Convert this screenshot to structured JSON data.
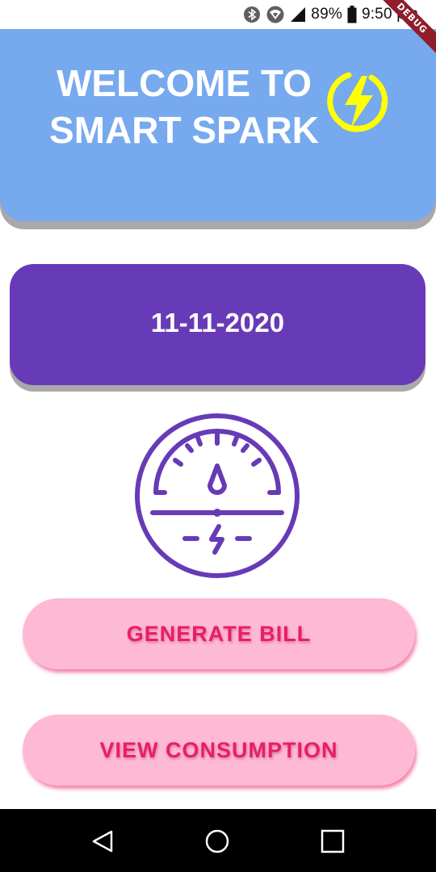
{
  "status_bar": {
    "battery_percent": "89%",
    "time": "9:50 pm",
    "icons": [
      "bluetooth-icon",
      "wifi-icon",
      "signal-icon",
      "battery-icon"
    ]
  },
  "debug_banner": "DEBUG",
  "header": {
    "title_line1": "WELCOME TO",
    "title_line2": "SMART SPARK",
    "logo_icon": "lightning-bolt-icon",
    "background_color": "#76a9ee",
    "logo_color": "#ffff00"
  },
  "date_card": {
    "date": "11-11-2020",
    "background_color": "#673ab7"
  },
  "meter_illustration": {
    "icon": "electric-meter-icon",
    "color": "#673ab7"
  },
  "buttons": {
    "generate_bill": "GENERATE BILL",
    "view_consumption": "VIEW CONSUMPTION",
    "background_color": "#feb9d5",
    "text_color": "#e91e63"
  },
  "nav_bar": {
    "back_icon": "back-triangle-icon",
    "home_icon": "home-circle-icon",
    "recents_icon": "recents-square-icon"
  }
}
